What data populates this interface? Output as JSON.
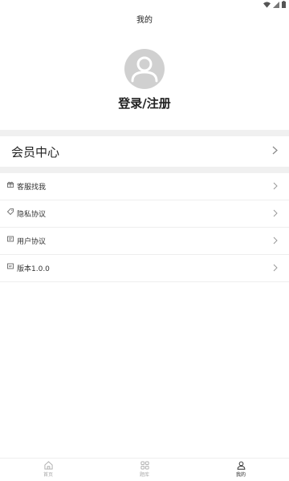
{
  "header": {
    "title": "我的"
  },
  "profile": {
    "login_label": "登录/注册"
  },
  "vip": {
    "label": "会员中心"
  },
  "menu": [
    {
      "label": "客服找我",
      "icon": "gift-icon"
    },
    {
      "label": "隐私协议",
      "icon": "tag-icon"
    },
    {
      "label": "用户协议",
      "icon": "document-icon"
    },
    {
      "label": "版本1.0.0",
      "icon": "version-icon"
    }
  ],
  "nav": [
    {
      "label": "首页",
      "icon": "home-icon",
      "active": false
    },
    {
      "label": "题库",
      "icon": "grid-icon",
      "active": false
    },
    {
      "label": "我的",
      "icon": "user-icon",
      "active": true
    }
  ],
  "colors": {
    "background": "#ffffff",
    "divider": "#f0f0f0",
    "avatar": "#d0d0d0",
    "inactive": "#aaaaaa",
    "text": "#222222"
  }
}
